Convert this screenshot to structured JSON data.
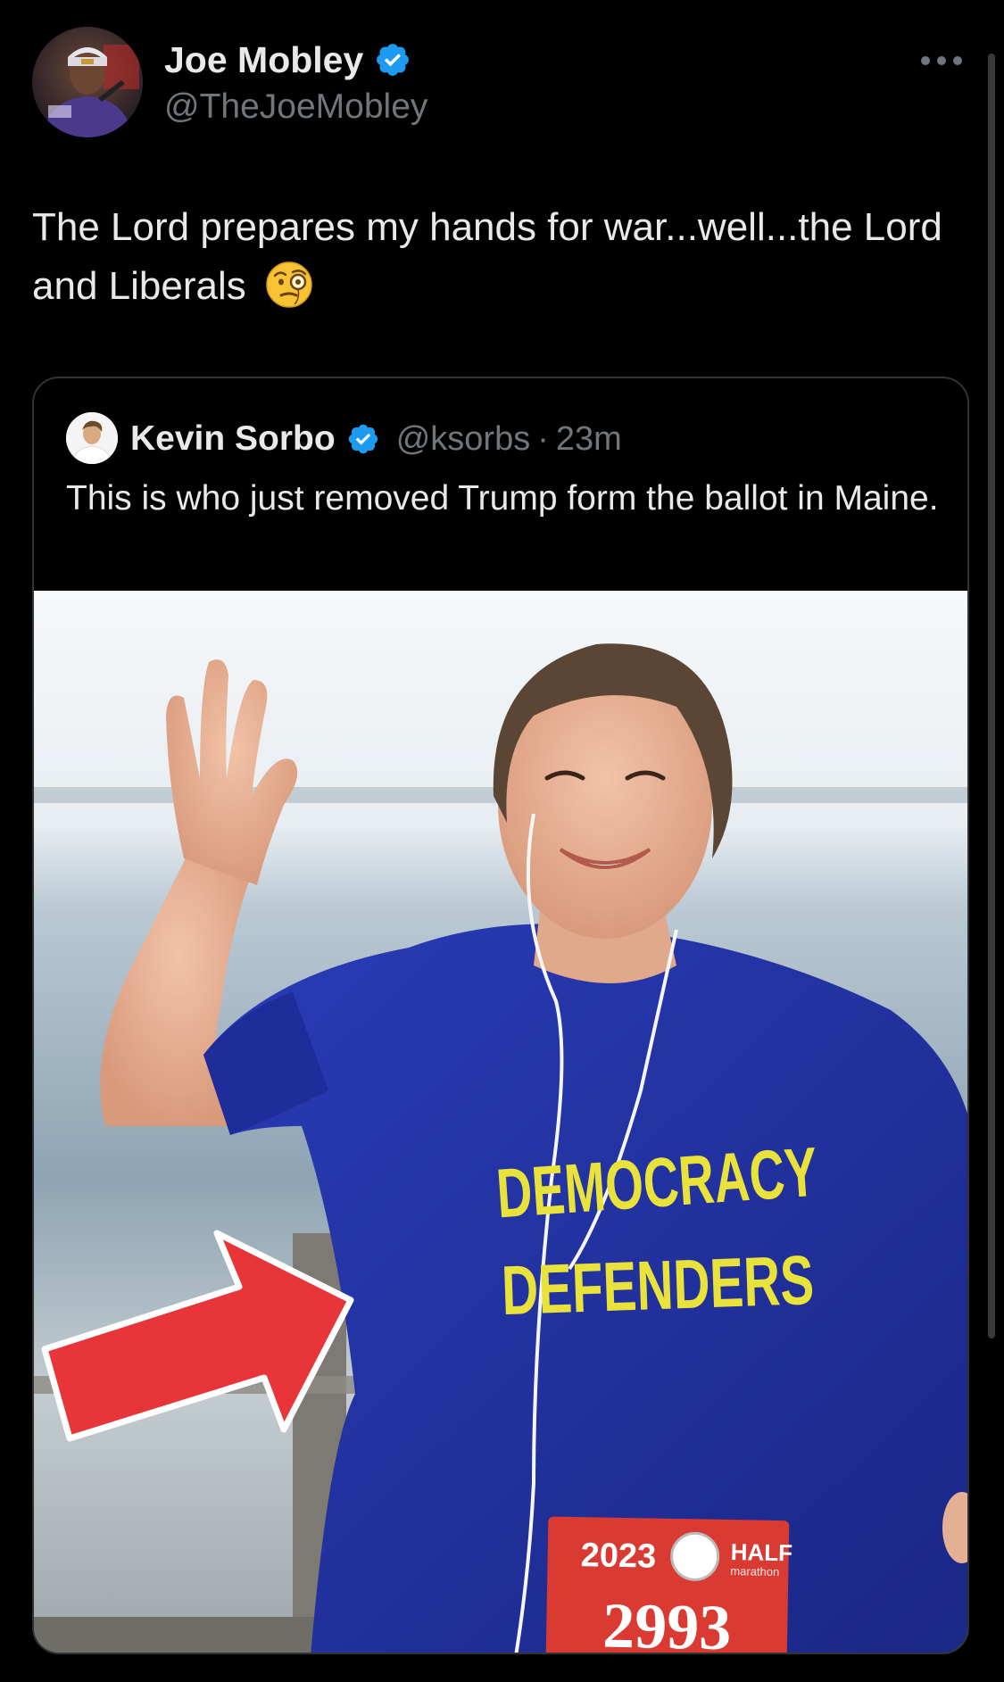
{
  "tweet": {
    "author": {
      "display_name": "Joe Mobley",
      "handle": "@TheJoeMobley",
      "verified": true,
      "avatar_icon": "person-avatar-icon"
    },
    "more_icon": "more-options-icon",
    "text": "The Lord prepares my hands for war...well...the Lord and Liberals",
    "emoji": "face-with-monocle",
    "quote": {
      "author": {
        "display_name": "Kevin Sorbo",
        "handle": "@ksorbs",
        "separator": "·",
        "time": "23m",
        "verified": true
      },
      "text": "This is who just removed Trump form the ballot in Maine.",
      "media": {
        "shirt_line1": "DEMOCRACY",
        "shirt_line2": "DEFENDERS",
        "bib_year": "2023",
        "bib_event": "HALF",
        "bib_event_sub": "marathon",
        "bib_number": "2993"
      }
    }
  },
  "colors": {
    "background": "#000000",
    "primary_text": "#e7e9ea",
    "secondary_text": "#71767b",
    "verified_blue": "#1d9bf0",
    "border": "#2f3336",
    "shirt_blue": "#2233a6",
    "shirt_text_yellow": "#e8e23a",
    "arrow_red": "#e8353a",
    "bib_red": "#d93a32"
  }
}
